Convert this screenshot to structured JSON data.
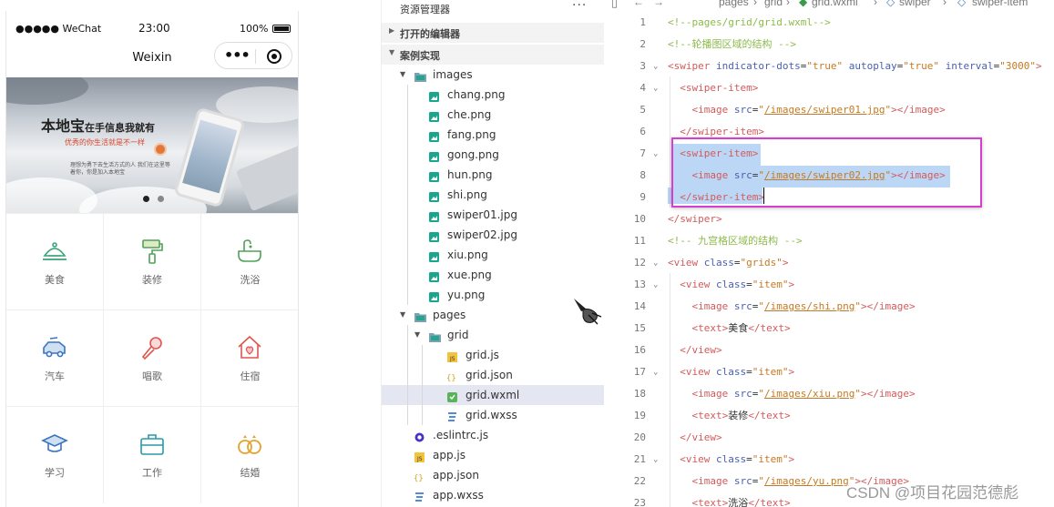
{
  "phone": {
    "status": {
      "carrier": "●●●●● WeChat",
      "time": "23:00",
      "battery": "100%"
    },
    "nav_title": "Weixin",
    "capsule": {
      "more": "•••"
    },
    "banner": {
      "title": "本地宝",
      "title_small": "在手信息我就有",
      "subtitle": "优秀的你生活就是不一样",
      "desc": "理想为勇下去生活方式的人 我们在这里等着你，你是加入本地宝",
      "active_dot": 1,
      "dot_count": 2
    },
    "grid_items": [
      {
        "label": "美食",
        "icon": "food-cloche-icon"
      },
      {
        "label": "装修",
        "icon": "paint-roller-icon"
      },
      {
        "label": "洗浴",
        "icon": "bath-tub-icon"
      },
      {
        "label": "汽车",
        "icon": "car-icon"
      },
      {
        "label": "唱歌",
        "icon": "microphone-icon"
      },
      {
        "label": "住宿",
        "icon": "house-icon"
      },
      {
        "label": "学习",
        "icon": "graduation-cap-icon"
      },
      {
        "label": "工作",
        "icon": "briefcase-icon"
      },
      {
        "label": "结婚",
        "icon": "rings-icon"
      }
    ]
  },
  "explorer": {
    "title": "资源管理器",
    "more": "···",
    "sections": [
      {
        "label": "打开的编辑器",
        "collapsed": true
      },
      {
        "label": "案例实现",
        "collapsed": false
      }
    ],
    "tree": [
      {
        "name": "images",
        "type": "folder-open"
      },
      {
        "name": "chang.png",
        "type": "image"
      },
      {
        "name": "che.png",
        "type": "image"
      },
      {
        "name": "fang.png",
        "type": "image"
      },
      {
        "name": "gong.png",
        "type": "image"
      },
      {
        "name": "hun.png",
        "type": "image"
      },
      {
        "name": "shi.png",
        "type": "image"
      },
      {
        "name": "swiper01.jpg",
        "type": "image"
      },
      {
        "name": "swiper02.jpg",
        "type": "image"
      },
      {
        "name": "xiu.png",
        "type": "image"
      },
      {
        "name": "xue.png",
        "type": "image"
      },
      {
        "name": "yu.png",
        "type": "image"
      },
      {
        "name": "pages",
        "type": "folder-open"
      },
      {
        "name": "grid",
        "type": "folder-open"
      },
      {
        "name": "grid.js",
        "type": "js"
      },
      {
        "name": "grid.json",
        "type": "json"
      },
      {
        "name": "grid.wxml",
        "type": "wxml",
        "selected": true
      },
      {
        "name": "grid.wxss",
        "type": "wxss"
      },
      {
        "name": ".eslintrc.js",
        "type": "eslint"
      },
      {
        "name": "app.js",
        "type": "js"
      },
      {
        "name": "app.json",
        "type": "json"
      },
      {
        "name": "app.wxss",
        "type": "wxss"
      }
    ]
  },
  "editor": {
    "breadcrumb": [
      "pages",
      "grid",
      "grid.wxml",
      "swiper",
      "swiper-item"
    ],
    "lines": [
      {
        "n": "1",
        "text": "<!--pages/grid/grid.wxml-->"
      },
      {
        "n": "2",
        "text": "<!--轮播图区域的结构 -->"
      },
      {
        "n": "3",
        "text": "<swiper indicator-dots=\"true\" autoplay=\"true\" interval=\"3000\">"
      },
      {
        "n": "4",
        "text": "  <swiper-item>"
      },
      {
        "n": "5",
        "text": "    <image src=\"/images/swiper01.jpg\"></image>"
      },
      {
        "n": "6",
        "text": "  </swiper-item>"
      },
      {
        "n": "7",
        "text": "  <swiper-item>"
      },
      {
        "n": "8",
        "text": "    <image src=\"/images/swiper02.jpg\"></image>"
      },
      {
        "n": "9",
        "text": "  </swiper-item>"
      },
      {
        "n": "10",
        "text": "</swiper>"
      },
      {
        "n": "11",
        "text": "<!-- 九宫格区域的结构 -->"
      },
      {
        "n": "12",
        "text": "<view class=\"grids\">"
      },
      {
        "n": "13",
        "text": "  <view class=\"item\">"
      },
      {
        "n": "14",
        "text": "    <image src=\"/images/shi.png\"></image>"
      },
      {
        "n": "15",
        "text": "    <text>美食</text>"
      },
      {
        "n": "16",
        "text": "  </view>"
      },
      {
        "n": "17",
        "text": "  <view class=\"item\">"
      },
      {
        "n": "18",
        "text": "    <image src=\"/images/xiu.png\"></image>"
      },
      {
        "n": "19",
        "text": "    <text>装修</text>"
      },
      {
        "n": "20",
        "text": "  </view>"
      },
      {
        "n": "21",
        "text": "  <view class=\"item\">"
      },
      {
        "n": "22",
        "text": "    <image src=\"/images/yu.png\"></image>"
      },
      {
        "n": "23",
        "text": "    <text>洗浴</text>"
      }
    ],
    "folded_lines": [
      "3",
      "4",
      "7",
      "12",
      "13",
      "17",
      "21"
    ],
    "selected_lines": [
      "7",
      "8",
      "9"
    ]
  },
  "watermark": "CSDN @项目花园范德彪",
  "colors": {
    "accent_box": "#d63ed1",
    "selection": "#bcd6f5",
    "comment": "#8dbb4c",
    "tag": "#d05c5c",
    "attr": "#4b5fae",
    "string": "#c47a23"
  }
}
